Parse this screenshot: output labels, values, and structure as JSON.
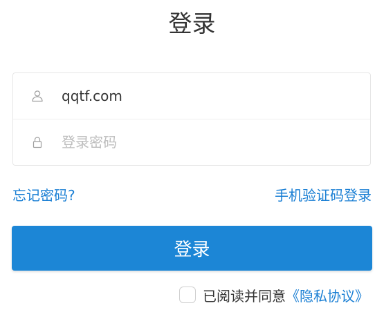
{
  "page": {
    "title": "登录"
  },
  "form": {
    "username": {
      "icon": "user-icon",
      "value": "qqtf.com"
    },
    "password": {
      "icon": "lock-icon",
      "value": "",
      "placeholder": "登录密码"
    }
  },
  "links": {
    "forgot_password": "忘记密码?",
    "sms_login": "手机验证码登录"
  },
  "login_button": {
    "label": "登录"
  },
  "agreement": {
    "checked": false,
    "text": "已阅读并同意",
    "privacy_link": "《隐私协议》"
  },
  "colors": {
    "accent": "#1c86d6",
    "link": "#1a7fd4",
    "text": "#333333",
    "placeholder": "#bdbdbd"
  }
}
